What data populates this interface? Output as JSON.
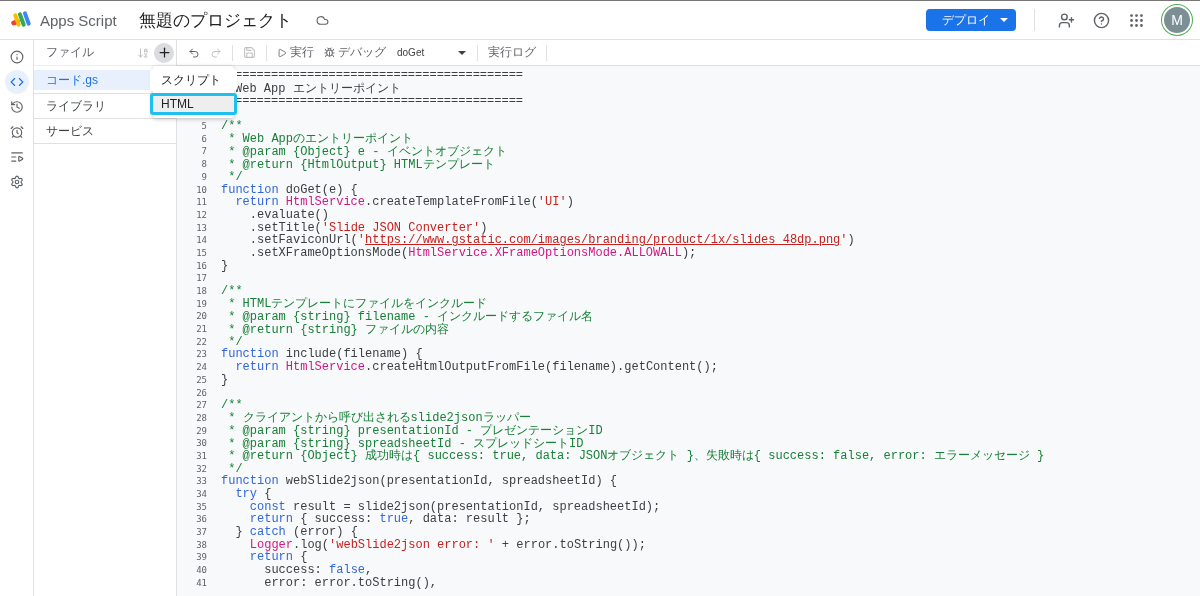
{
  "top_bar": {
    "app_name": "Apps Script",
    "project_title": "無題のプロジェクト",
    "deploy_button": {
      "label": "デプロイ"
    },
    "avatar": {
      "initial": "M"
    }
  },
  "rail": [
    {
      "kind": "info",
      "selected": false
    },
    {
      "kind": "editor",
      "selected": true
    },
    {
      "kind": "history",
      "selected": false
    },
    {
      "kind": "triggers",
      "selected": false
    },
    {
      "kind": "executions",
      "selected": false
    },
    {
      "kind": "settings",
      "selected": false
    }
  ],
  "files_panel": {
    "title": "ファイル",
    "files": [
      {
        "name": "コード.gs",
        "selected": true
      }
    ],
    "sections": [
      {
        "label": "ライブラリ"
      },
      {
        "label": "サービス"
      }
    ]
  },
  "toolbar": {
    "run": "実行",
    "debug": "デバッグ",
    "function_select": "doGet",
    "log": "実行ログ"
  },
  "new_file_menu": {
    "items": [
      {
        "label": "スクリプト",
        "selected": false
      },
      {
        "label": "HTML",
        "selected": true
      }
    ]
  },
  "editor": {
    "lines": [
      {
        "kind": "partial",
        "tokens": [
          {
            "kind": "text",
            "text": "========================================"
          }
        ]
      },
      {
        "kind": "partial",
        "tokens": [
          {
            "kind": "text",
            "text": "Web App エントリーポイント"
          }
        ]
      },
      {
        "kind": "partial",
        "tokens": [
          {
            "kind": "text",
            "text": "========================================"
          }
        ]
      },
      {
        "kind": "code",
        "number": "5",
        "tokens": [
          {
            "kind": "comment",
            "text": "/**"
          }
        ]
      },
      {
        "kind": "code",
        "number": "6",
        "tokens": [
          {
            "kind": "comment",
            "text": " * Web Appのエントリーポイント"
          }
        ]
      },
      {
        "kind": "code",
        "number": "7",
        "tokens": [
          {
            "kind": "comment",
            "text": " * @param {Object} e - イベントオブジェクト"
          }
        ]
      },
      {
        "kind": "code",
        "number": "8",
        "tokens": [
          {
            "kind": "comment",
            "text": " * @return {HtmlOutput} HTMLテンプレート"
          }
        ]
      },
      {
        "kind": "code",
        "number": "9",
        "tokens": [
          {
            "kind": "comment",
            "text": " */"
          }
        ]
      },
      {
        "kind": "code",
        "number": "10",
        "tokens": [
          {
            "kind": "keyword",
            "text": "function"
          },
          {
            "kind": "text",
            "text": " doGet(e) {"
          }
        ]
      },
      {
        "kind": "code",
        "number": "11",
        "tokens": [
          {
            "kind": "keyword",
            "text": "  return"
          },
          {
            "kind": "service",
            "text": " HtmlService"
          },
          {
            "kind": "text",
            "text": ".createTemplateFromFile("
          },
          {
            "kind": "string",
            "text": "'UI'"
          },
          {
            "kind": "text",
            "text": ")"
          }
        ]
      },
      {
        "kind": "code",
        "number": "12",
        "tokens": [
          {
            "kind": "text",
            "text": "    .evaluate()"
          }
        ]
      },
      {
        "kind": "code",
        "number": "13",
        "tokens": [
          {
            "kind": "text",
            "text": "    .setTitle("
          },
          {
            "kind": "string",
            "text": "'Slide JSON Converter'"
          },
          {
            "kind": "text",
            "text": ")"
          }
        ]
      },
      {
        "kind": "code",
        "number": "14",
        "tokens": [
          {
            "kind": "text",
            "text": "    .setFaviconUrl("
          },
          {
            "kind": "string",
            "text": "'"
          },
          {
            "kind": "link",
            "text": "https://www.gstatic.com/images/branding/product/1x/slides_48dp.png"
          },
          {
            "kind": "string",
            "text": "'"
          },
          {
            "kind": "text",
            "text": ")"
          }
        ]
      },
      {
        "kind": "code",
        "number": "15",
        "tokens": [
          {
            "kind": "text",
            "text": "    .setXFrameOptionsMode("
          },
          {
            "kind": "service",
            "text": "HtmlService.XFrameOptionsMode.ALLOWALL"
          },
          {
            "kind": "text",
            "text": ");"
          }
        ]
      },
      {
        "kind": "code",
        "number": "16",
        "tokens": [
          {
            "kind": "text",
            "text": "}"
          }
        ]
      },
      {
        "kind": "code",
        "number": "17"
      },
      {
        "kind": "code",
        "number": "18",
        "tokens": [
          {
            "kind": "comment",
            "text": "/**"
          }
        ]
      },
      {
        "kind": "code",
        "number": "19",
        "tokens": [
          {
            "kind": "comment",
            "text": " * HTMLテンプレートにファイルをインクルード"
          }
        ]
      },
      {
        "kind": "code",
        "number": "20",
        "tokens": [
          {
            "kind": "comment",
            "text": " * @param {string} filename - インクルードするファイル名"
          }
        ]
      },
      {
        "kind": "code",
        "number": "21",
        "tokens": [
          {
            "kind": "comment",
            "text": " * @return {string} ファイルの内容"
          }
        ]
      },
      {
        "kind": "code",
        "number": "22",
        "tokens": [
          {
            "kind": "comment",
            "text": " */"
          }
        ]
      },
      {
        "kind": "code",
        "number": "23",
        "tokens": [
          {
            "kind": "keyword",
            "text": "function"
          },
          {
            "kind": "text",
            "text": " include(filename) {"
          }
        ]
      },
      {
        "kind": "code",
        "number": "24",
        "tokens": [
          {
            "kind": "keyword",
            "text": "  return"
          },
          {
            "kind": "service",
            "text": " HtmlService"
          },
          {
            "kind": "text",
            "text": ".createHtmlOutputFromFile(filename).getContent();"
          }
        ]
      },
      {
        "kind": "code",
        "number": "25",
        "tokens": [
          {
            "kind": "text",
            "text": "}"
          }
        ]
      },
      {
        "kind": "code",
        "number": "26"
      },
      {
        "kind": "code",
        "number": "27",
        "tokens": [
          {
            "kind": "comment",
            "text": "/**"
          }
        ]
      },
      {
        "kind": "code",
        "number": "28",
        "tokens": [
          {
            "kind": "comment",
            "text": " * クライアントから呼び出されるslide2jsonラッパー"
          }
        ]
      },
      {
        "kind": "code",
        "number": "29",
        "tokens": [
          {
            "kind": "comment",
            "text": " * @param {string} presentationId - プレゼンテーションID"
          }
        ]
      },
      {
        "kind": "code",
        "number": "30",
        "tokens": [
          {
            "kind": "comment",
            "text": " * @param {string} spreadsheetId - スプレッドシートID"
          }
        ]
      },
      {
        "kind": "code",
        "number": "31",
        "tokens": [
          {
            "kind": "comment",
            "text": " * @return {Object} 成功時は{ success: true, data: JSONオブジェクト }、失敗時は{ success: false, error: エラーメッセージ }"
          }
        ]
      },
      {
        "kind": "code",
        "number": "32",
        "tokens": [
          {
            "kind": "comment",
            "text": " */"
          }
        ]
      },
      {
        "kind": "code",
        "number": "33",
        "tokens": [
          {
            "kind": "keyword",
            "text": "function"
          },
          {
            "kind": "text",
            "text": " webSlide2json(presentationId, spreadsheetId) {"
          }
        ]
      },
      {
        "kind": "code",
        "number": "34",
        "tokens": [
          {
            "kind": "keyword",
            "text": "  try"
          },
          {
            "kind": "text",
            "text": " {"
          }
        ]
      },
      {
        "kind": "code",
        "number": "35",
        "tokens": [
          {
            "kind": "keyword",
            "text": "    const"
          },
          {
            "kind": "text",
            "text": " result = slide2json(presentationId, spreadsheetId);"
          }
        ]
      },
      {
        "kind": "code",
        "number": "36",
        "tokens": [
          {
            "kind": "keyword",
            "text": "    return"
          },
          {
            "kind": "text",
            "text": " { success: "
          },
          {
            "kind": "keyword",
            "text": "true"
          },
          {
            "kind": "text",
            "text": ", data: result };"
          }
        ]
      },
      {
        "kind": "code",
        "number": "37",
        "tokens": [
          {
            "kind": "text",
            "text": "  } "
          },
          {
            "kind": "keyword",
            "text": "catch"
          },
          {
            "kind": "text",
            "text": " (error) {"
          }
        ]
      },
      {
        "kind": "code",
        "number": "38",
        "tokens": [
          {
            "kind": "service",
            "text": "    Logger"
          },
          {
            "kind": "text",
            "text": ".log("
          },
          {
            "kind": "string",
            "text": "'webSlide2json error: '"
          },
          {
            "kind": "text",
            "text": " + error.toString());"
          }
        ]
      },
      {
        "kind": "code",
        "number": "39",
        "tokens": [
          {
            "kind": "keyword",
            "text": "    return"
          },
          {
            "kind": "text",
            "text": " {"
          }
        ]
      },
      {
        "kind": "code",
        "number": "40",
        "tokens": [
          {
            "kind": "text",
            "text": "      success: "
          },
          {
            "kind": "keyword",
            "text": "false"
          },
          {
            "kind": "text",
            "text": ","
          }
        ]
      },
      {
        "kind": "code",
        "number": "41",
        "tokens": [
          {
            "kind": "text",
            "text": "      error: error.toString(),"
          }
        ]
      }
    ]
  }
}
